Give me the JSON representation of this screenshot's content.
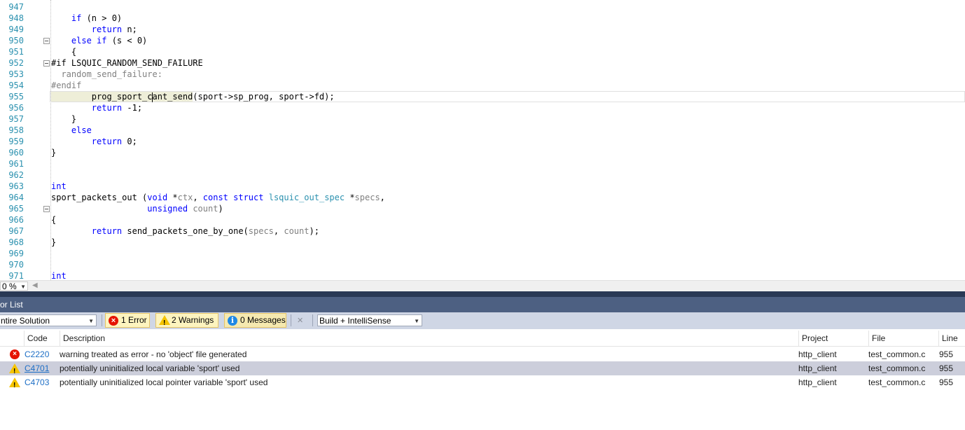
{
  "editor": {
    "lines": [
      {
        "n": "947"
      },
      {
        "n": "948",
        "t": [
          "    ",
          "if",
          " (n > 0)"
        ]
      },
      {
        "n": "949",
        "t": [
          "        ",
          "return",
          " n;"
        ]
      },
      {
        "n": "950",
        "t": [
          "    ",
          "else if",
          " (s < 0)"
        ]
      },
      {
        "n": "951",
        "t": [
          "    {"
        ]
      },
      {
        "n": "952",
        "t": [
          "#if LSQUIC_RANDOM_SEND_FAILURE"
        ]
      },
      {
        "n": "953",
        "t": [
          "  random_send_failure:"
        ]
      },
      {
        "n": "954",
        "t": [
          "#endif"
        ]
      },
      {
        "n": "955",
        "t": [
          "        prog_sport_c",
          "ant_send",
          "(sport->sp_prog, sport->fd);"
        ]
      },
      {
        "n": "956",
        "t": [
          "        ",
          "return",
          " -1;"
        ]
      },
      {
        "n": "957",
        "t": [
          "    }"
        ]
      },
      {
        "n": "958",
        "t": [
          "    ",
          "else"
        ]
      },
      {
        "n": "959",
        "t": [
          "        ",
          "return",
          " 0;"
        ]
      },
      {
        "n": "960",
        "t": [
          "}"
        ]
      },
      {
        "n": "961"
      },
      {
        "n": "962"
      },
      {
        "n": "963",
        "t": [
          "int"
        ]
      },
      {
        "n": "964",
        "t": [
          "sport_packets_out (",
          "void",
          " *",
          "ctx",
          ", ",
          "const struct",
          " ",
          "lsquic_out_spec",
          " *",
          "specs",
          ","
        ]
      },
      {
        "n": "965",
        "t": [
          "                   ",
          "unsigned",
          " ",
          "count",
          ")"
        ]
      },
      {
        "n": "966",
        "t": [
          "{"
        ]
      },
      {
        "n": "967",
        "t": [
          "        ",
          "return",
          " send_packets_one_by_one(",
          "specs",
          ", ",
          "count",
          ");"
        ]
      },
      {
        "n": "968",
        "t": [
          "}"
        ]
      },
      {
        "n": "969"
      },
      {
        "n": "970"
      },
      {
        "n": "971",
        "t": [
          "int"
        ]
      }
    ]
  },
  "zoom": {
    "value": "0 %"
  },
  "panel": {
    "title": "or List"
  },
  "toolbar": {
    "scope": "ntire Solution",
    "errors_label": "1 Error",
    "warnings_label": "2 Warnings",
    "messages_label": "0 Messages",
    "build_filter": "Build + IntelliSense"
  },
  "grid": {
    "headers": {
      "code": "Code",
      "description": "Description",
      "project": "Project",
      "file": "File",
      "line": "Line"
    },
    "rows": [
      {
        "severity": "error",
        "code": "C2220",
        "description": "warning treated as error - no 'object' file generated",
        "project": "http_client",
        "file": "test_common.c",
        "line": "955"
      },
      {
        "severity": "warning",
        "code": "C4701",
        "description": "potentially uninitialized local variable 'sport' used",
        "project": "http_client",
        "file": "test_common.c",
        "line": "955"
      },
      {
        "severity": "warning",
        "code": "C4703",
        "description": "potentially uninitialized local pointer variable 'sport' used",
        "project": "http_client",
        "file": "test_common.c",
        "line": "955"
      }
    ]
  },
  "colors": {
    "keyword": "#0000ff",
    "type": "#2b91af",
    "line_number": "#2b91af",
    "panel_title_bg": "#4d6082",
    "selected_row": "#cccedb"
  }
}
